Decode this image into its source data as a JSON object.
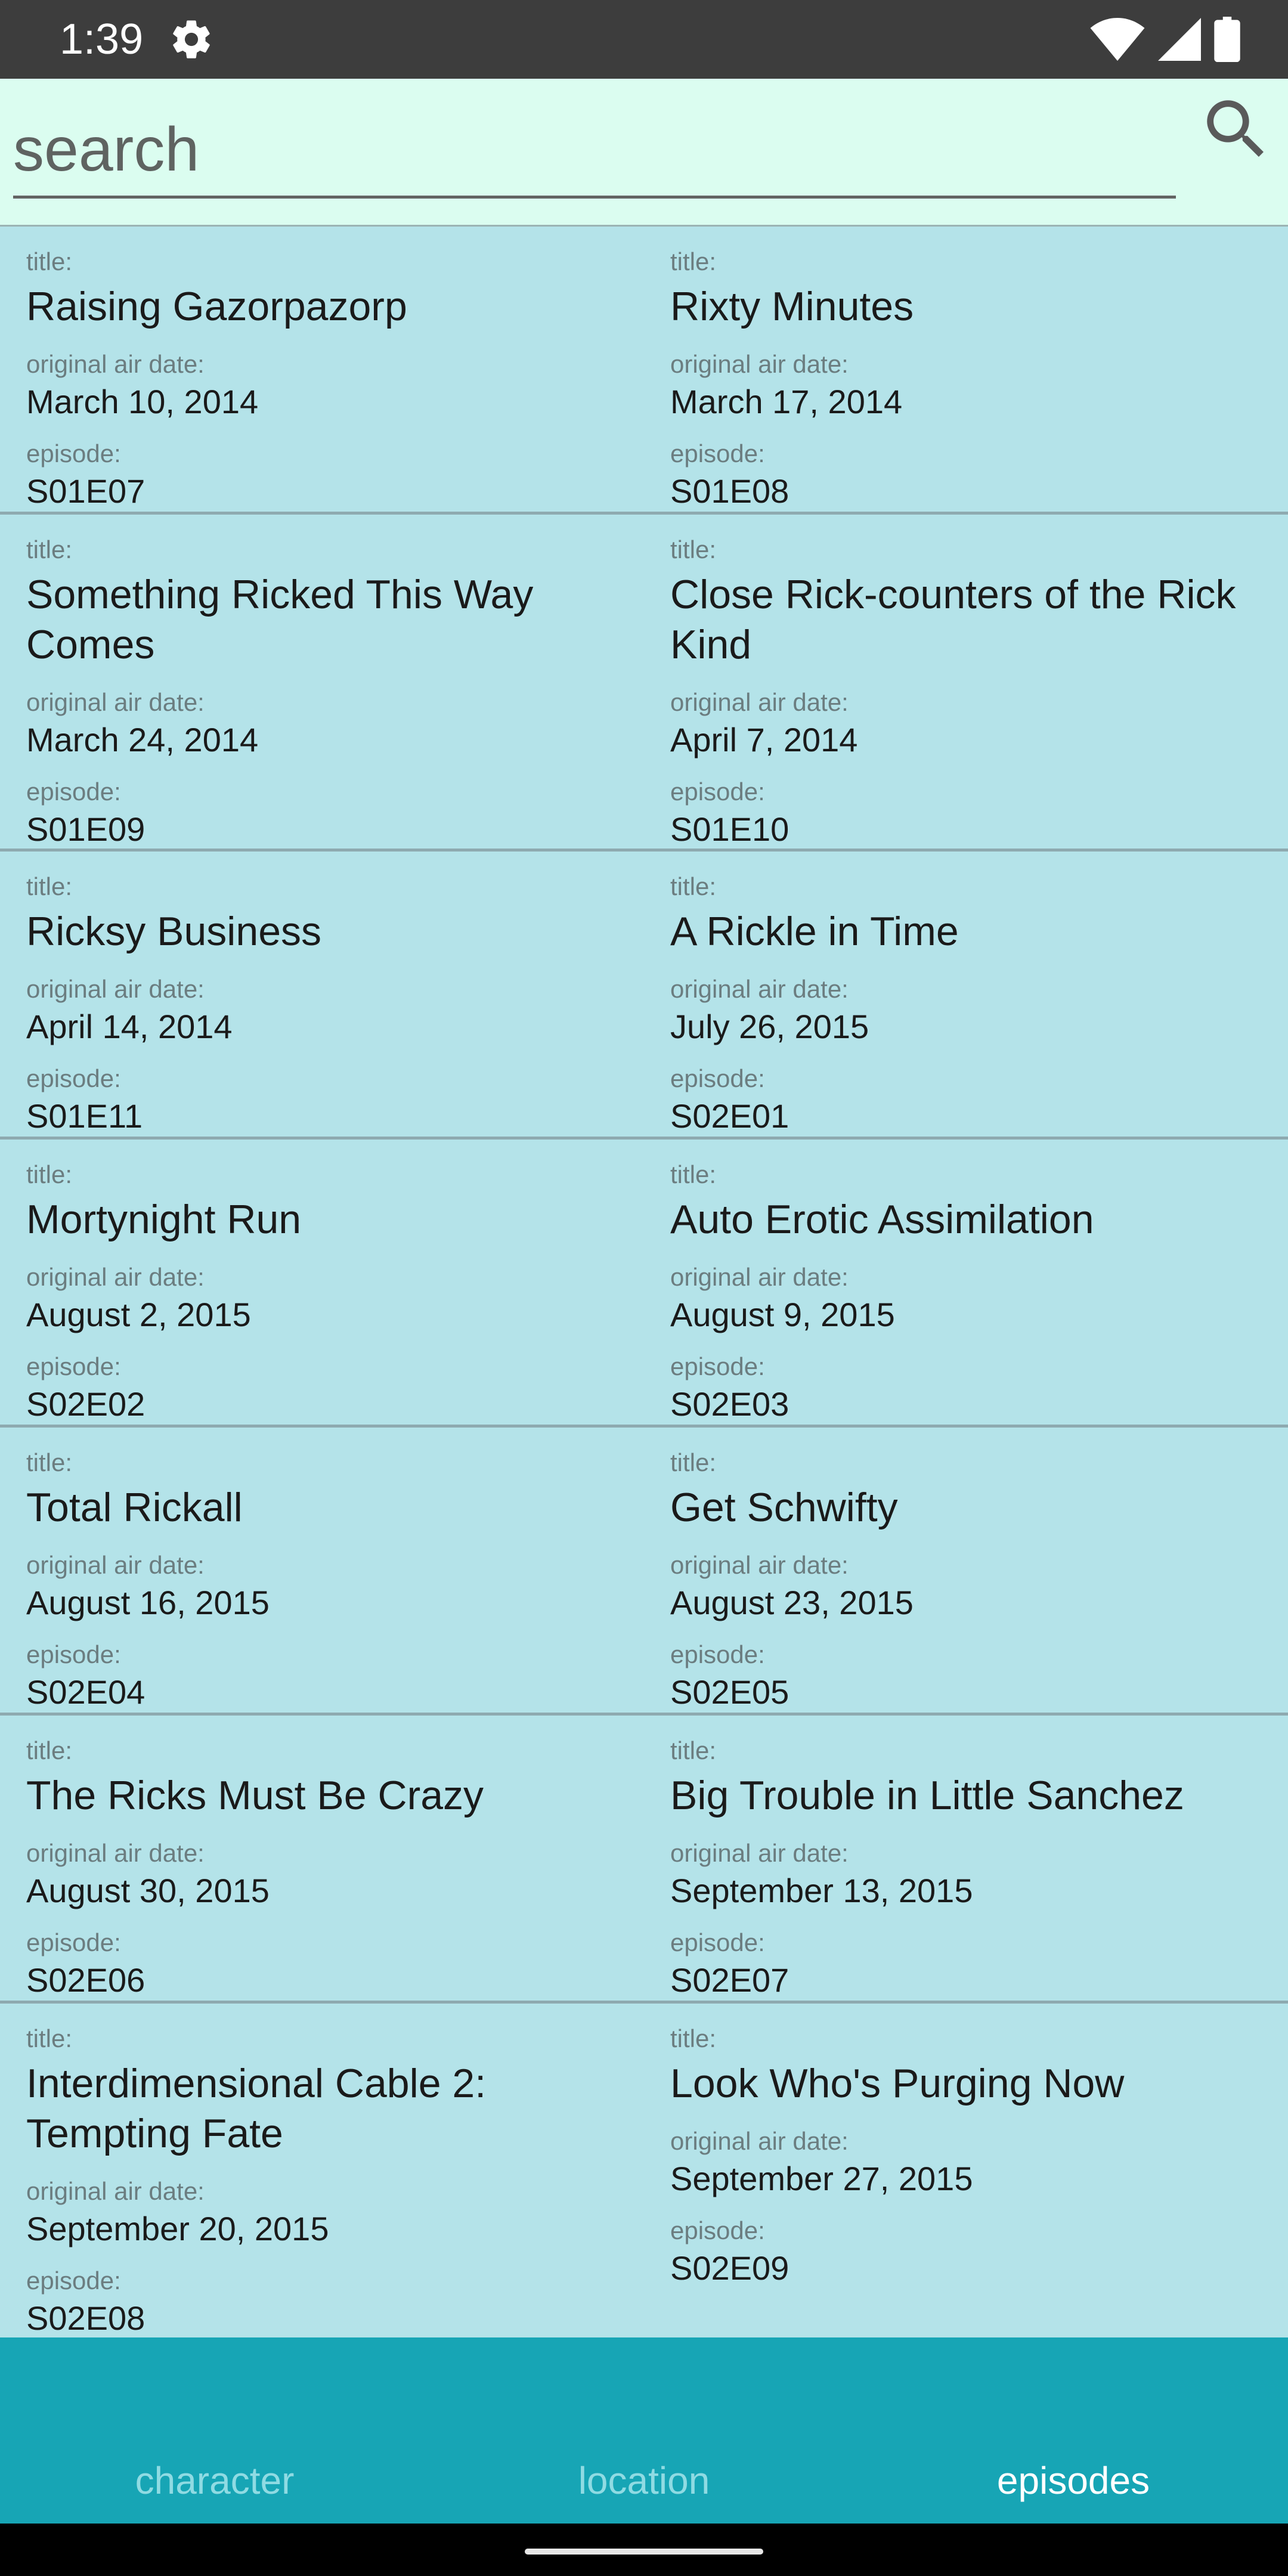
{
  "status": {
    "time": "1:39",
    "icons": [
      "settings-gear-icon",
      "wifi-icon",
      "cell-signal-icon",
      "battery-icon"
    ]
  },
  "search": {
    "placeholder": "search",
    "value": ""
  },
  "labels": {
    "title": "title:",
    "air_date": "original air date:",
    "episode": "episode:"
  },
  "episodes": [
    {
      "name": "Raising Gazorpazorp",
      "air_date": "March 10, 2014",
      "episode": "S01E07"
    },
    {
      "name": "Rixty Minutes",
      "air_date": "March 17, 2014",
      "episode": "S01E08"
    },
    {
      "name": "Something Ricked This Way Comes",
      "air_date": "March 24, 2014",
      "episode": "S01E09"
    },
    {
      "name": "Close Rick-counters of the Rick Kind",
      "air_date": "April 7, 2014",
      "episode": "S01E10"
    },
    {
      "name": "Ricksy Business",
      "air_date": "April 14, 2014",
      "episode": "S01E11"
    },
    {
      "name": "A Rickle in Time",
      "air_date": "July 26, 2015",
      "episode": "S02E01"
    },
    {
      "name": "Mortynight Run",
      "air_date": "August 2, 2015",
      "episode": "S02E02"
    },
    {
      "name": "Auto Erotic Assimilation",
      "air_date": "August 9, 2015",
      "episode": "S02E03"
    },
    {
      "name": "Total Rickall",
      "air_date": "August 16, 2015",
      "episode": "S02E04"
    },
    {
      "name": "Get Schwifty",
      "air_date": "August 23, 2015",
      "episode": "S02E05"
    },
    {
      "name": "The Ricks Must Be Crazy",
      "air_date": "August 30, 2015",
      "episode": "S02E06"
    },
    {
      "name": "Big Trouble in Little Sanchez",
      "air_date": "September 13, 2015",
      "episode": "S02E07"
    },
    {
      "name": "Interdimensional Cable 2: Tempting Fate",
      "air_date": "September 20, 2015",
      "episode": "S02E08"
    },
    {
      "name": "Look Who's Purging Now",
      "air_date": "September 27, 2015",
      "episode": "S02E09"
    }
  ],
  "nav": {
    "tabs": [
      {
        "label": "character",
        "active": false
      },
      {
        "label": "location",
        "active": false
      },
      {
        "label": "episodes",
        "active": true
      }
    ]
  },
  "colors": {
    "status_bar": "#3d3d3d",
    "search_bg": "#dbfdf0",
    "list_bg": "#b4e3e9",
    "nav_bg": "#17a5b5"
  }
}
